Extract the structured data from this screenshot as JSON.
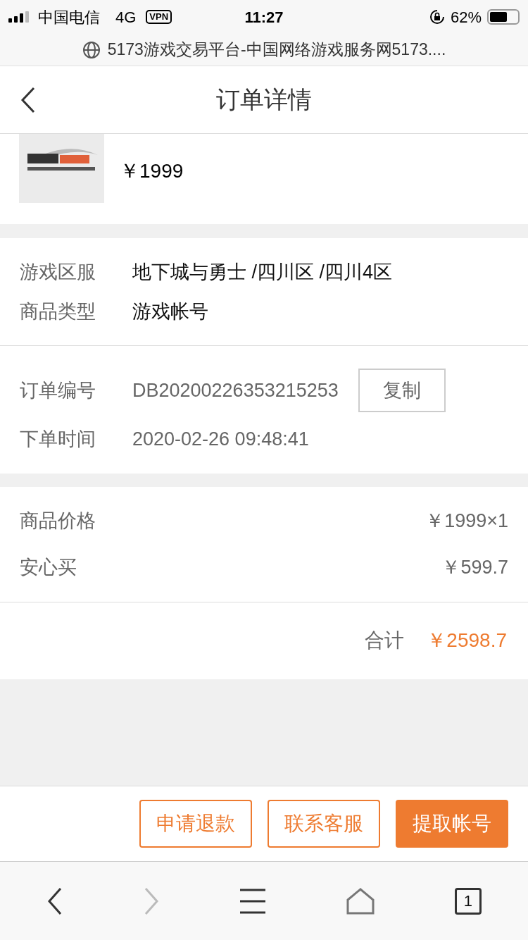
{
  "status_bar": {
    "carrier": "中国电信",
    "network": "4G",
    "vpn": "VPN",
    "time": "11:27",
    "battery": "62%"
  },
  "url_bar": {
    "title": "5173游戏交易平台-中国网络游戏服务网5173...."
  },
  "header": {
    "title": "订单详情"
  },
  "product": {
    "price": "￥1999"
  },
  "info": [
    {
      "label": "游戏区服",
      "value": "地下城与勇士 /四川区 /四川4区"
    },
    {
      "label": "商品类型",
      "value": "游戏帐号"
    }
  ],
  "order": {
    "number_label": "订单编号",
    "number": "DB20200226353215253",
    "copy_button": "复制",
    "time_label": "下单时间",
    "time": "2020-02-26 09:48:41"
  },
  "costs": [
    {
      "label": "商品价格",
      "value": "￥1999×1"
    },
    {
      "label": "安心买",
      "value": "￥599.7"
    }
  ],
  "total": {
    "label": "合计",
    "value": "￥2598.7"
  },
  "actions": [
    {
      "label": "申请退款",
      "kind": "outline"
    },
    {
      "label": "联系客服",
      "kind": "outline"
    },
    {
      "label": "提取帐号",
      "kind": "filled"
    }
  ],
  "browser_bar": {
    "tab_count": "1"
  }
}
